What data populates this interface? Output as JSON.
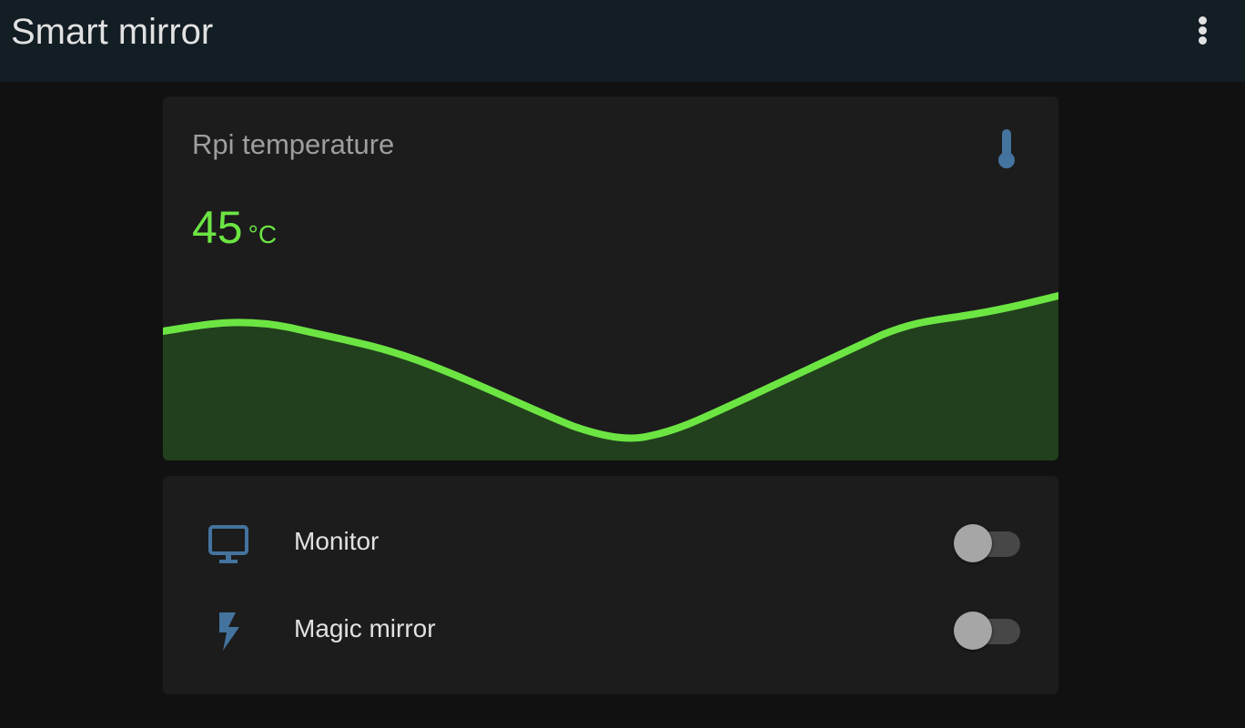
{
  "header": {
    "title": "Smart mirror",
    "menu_icon": "dots-vertical-icon"
  },
  "sensor_card": {
    "name": "Rpi temperature",
    "value": "45",
    "unit": "°C",
    "icon": "thermometer-icon",
    "icon_color": "#44739e",
    "graph_color": "#6ce543"
  },
  "entities": [
    {
      "label": "Monitor",
      "icon": "monitor-icon",
      "state": "off"
    },
    {
      "label": "Magic mirror",
      "icon": "flash-icon",
      "state": "off"
    }
  ],
  "colors": {
    "accent": "#6ce543",
    "icon": "#44739e",
    "background": "#111111",
    "card": "#1c1c1c",
    "header": "#121d24"
  }
}
